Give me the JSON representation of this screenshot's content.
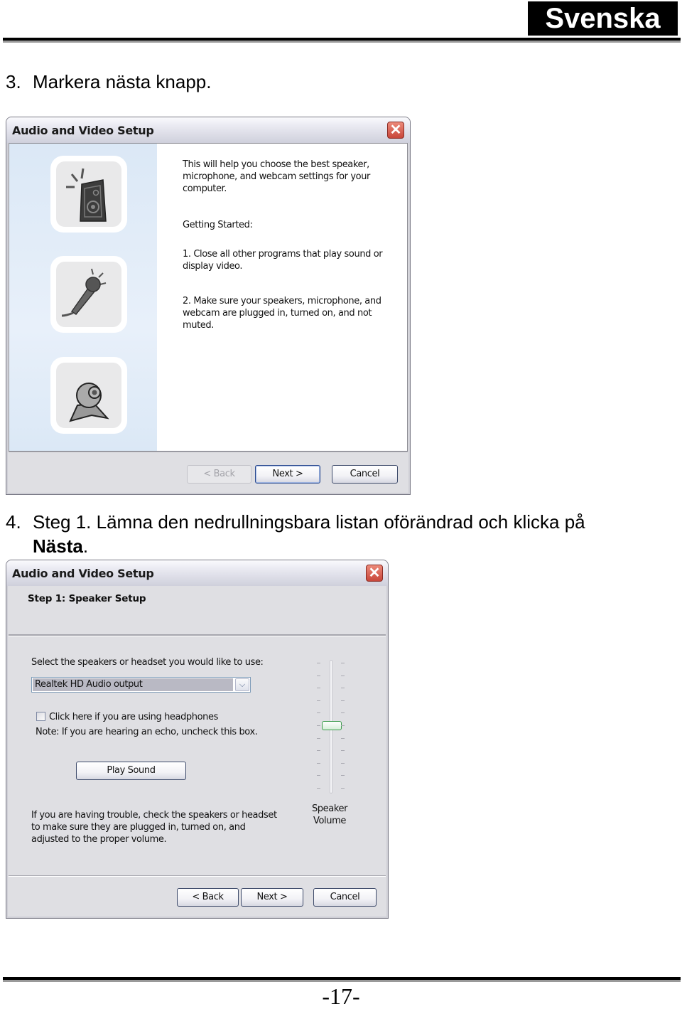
{
  "header": {
    "language": "Svenska"
  },
  "steps": [
    {
      "number": "3.",
      "text": "Markera nästa knapp."
    },
    {
      "number": "4.",
      "text": "Steg 1. Lämna den nedrullningsbara listan oförändrad och klicka på",
      "text_line2_bold": "Nästa",
      "text_line2_tail": "."
    }
  ],
  "dialog1": {
    "title": "Audio and Video Setup",
    "close_icon": "close-x",
    "icons": [
      "speaker-icon",
      "microphone-icon",
      "webcam-icon"
    ],
    "intro": [
      "This will help you choose the best speaker,",
      "microphone, and webcam settings for your",
      "computer."
    ],
    "getting_started": "Getting Started:",
    "item1": [
      "1. Close all other programs that play sound or",
      "display video."
    ],
    "item2": [
      "2. Make sure your speakers, microphone, and",
      "webcam are plugged in, turned on, and not",
      "muted."
    ],
    "buttons": {
      "back": "< Back",
      "next": "Next >",
      "cancel": "Cancel"
    },
    "back_enabled": false
  },
  "dialog2": {
    "title": "Audio and Video Setup",
    "step_heading": "Step 1: Speaker Setup",
    "select_label": "Select the speakers or headset you would like to use:",
    "select_value": "Realtek HD Audio output",
    "headphones_checkbox": {
      "label": "Click here if you are using headphones",
      "checked": false
    },
    "note": "Note: If you are hearing an echo, uncheck this box.",
    "play_sound": "Play Sound",
    "trouble": [
      "If you are having trouble, check the speakers or headset",
      "to make sure they are plugged in, turned on, and",
      "adjusted to the proper volume."
    ],
    "volume": {
      "label_line1": "Speaker",
      "label_line2": "Volume",
      "ticks": 11,
      "level_fraction": 0.5
    },
    "buttons": {
      "back": "< Back",
      "next": "Next >",
      "cancel": "Cancel"
    }
  },
  "footer": {
    "page": "-17-"
  }
}
